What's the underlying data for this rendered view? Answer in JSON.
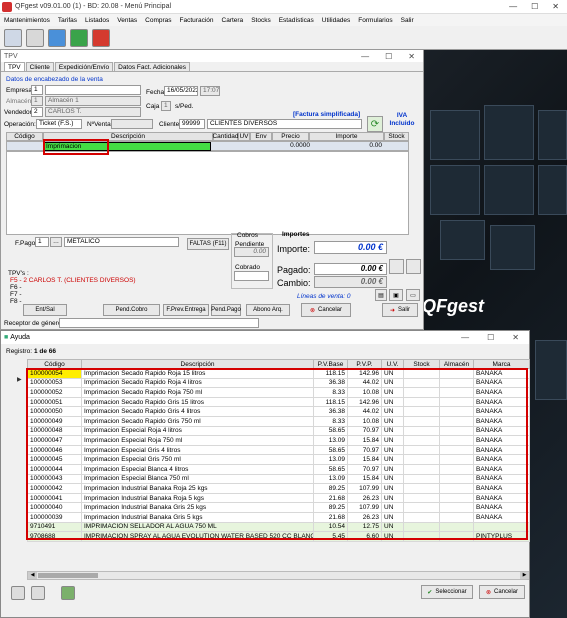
{
  "app": {
    "title": "QFgest v09.01.00 (1) - BD: 20.08 - Menú Principal",
    "menu": [
      "Mantenimientos",
      "Tarifas",
      "Listados",
      "Ventas",
      "Compras",
      "Facturación",
      "Cartera",
      "Stocks",
      "Estadísticas",
      "Utilidades",
      "Formularios",
      "Salir"
    ]
  },
  "tpv": {
    "title": "TPV",
    "tabs": [
      "TPV",
      "Cliente",
      "Expedición/Envío",
      "Datos Fact. Adicionales"
    ],
    "section": "Datos de encabezado de la venta",
    "empresa_label": "Empresa:",
    "empresa_code": "1",
    "empresa_name": "",
    "almacen_label": "Almacén:",
    "almacen_code": "1",
    "almacen_name": "Almacén 1",
    "vendedor_label": "Vendedor:",
    "vendedor_code": "2",
    "vendedor_name": "CARLOS T.",
    "fecha_label": "Fecha:",
    "fecha": "16/05/2022",
    "hora": "17:07",
    "caja_label": "Caja",
    "caja": "1",
    "sped_label": "s/Ped.",
    "factura_simplificada": "[Factura simplificada]",
    "iva_incluido": "IVA Incluido",
    "operacion_label": "Operación:",
    "operacion": "Ticket (F.S.)",
    "nventa_label": "NºVenta:",
    "cliente_label": "Cliente:",
    "cliente_code": "99999",
    "cliente_name": "CLIENTES DIVERSOS",
    "grid_headers": [
      "Código",
      "Descripción",
      "Cantidad",
      "UV",
      "Env",
      "Precio",
      "Importe",
      "Stock"
    ],
    "grid_row": {
      "codigo": "Imprimacion",
      "precio": "0.0000",
      "importe": "0.00"
    },
    "fpago_label": "F.Pago:",
    "fpago_code": "1",
    "fpago_name": "METALICO",
    "faltas_btn": "FALTAS (F11)",
    "cobros_label": "Cobros",
    "pendiente_label": "Pendiente",
    "pendiente_val": "0.00",
    "cobrado_label": "Cobrado",
    "importes_label": "Importes",
    "importe_label": "Importe:",
    "importe_val": "0.00 €",
    "pagado_label": "Pagado:",
    "pagado_val": "0.00 €",
    "cambio_label": "Cambio:",
    "cambio_val": "0.00 €",
    "lineas_label": "Líneas de venta: 0",
    "tpvs_label": "TPV's :",
    "f5_line": "F5 - 2 CARLOS T. (CLIENTES DIVERSOS)",
    "f6": "F6 -",
    "f7": "F7 -",
    "f8": "F8 -",
    "buttons": {
      "ent_sal": "Ent/Sal",
      "pend_cobro": "Pend.Cobro",
      "f_prev": "F.Prev.Entrega",
      "pend_pago": "Pend.Pago",
      "abono": "Abono Arq.",
      "cancelar": "Cancelar",
      "salir": "Salir"
    },
    "receptor_label": "Receptor de género"
  },
  "ayuda": {
    "title": "Ayuda",
    "registro": "Registro:",
    "registro_val": "1 de 66",
    "headers": [
      "Código",
      "Descripción",
      "P.V.Base",
      "P.V.P.",
      "U.V.",
      "Stock",
      "Almacén",
      "Marca"
    ],
    "rows": [
      [
        "100000054",
        "Imprimacion Secado Rapido Roja 15 litros",
        "118.15",
        "142.96",
        "UN",
        "",
        "",
        "BANAKA"
      ],
      [
        "100000053",
        "Imprimacion Secado Rapido Roja 4 litros",
        "36.38",
        "44.02",
        "UN",
        "",
        "",
        "BANAKA"
      ],
      [
        "100000052",
        "Imprimacion Secado Rapido Roja 750 ml",
        "8.33",
        "10.08",
        "UN",
        "",
        "",
        "BANAKA"
      ],
      [
        "100000051",
        "Imprimacion Secado Rapido Gris 15 litros",
        "118.15",
        "142.96",
        "UN",
        "",
        "",
        "BANAKA"
      ],
      [
        "100000050",
        "Imprimacion Secado Rapido Gris 4 litros",
        "36.38",
        "44.02",
        "UN",
        "",
        "",
        "BANAKA"
      ],
      [
        "100000049",
        "Imprimacion Secado Rapido Gris 750 ml",
        "8.33",
        "10.08",
        "UN",
        "",
        "",
        "BANAKA"
      ],
      [
        "100000048",
        "Imprimacion Especial Roja 4 litros",
        "58.65",
        "70.97",
        "UN",
        "",
        "",
        "BANAKA"
      ],
      [
        "100000047",
        "Imprimacion Especial Roja 750 ml",
        "13.09",
        "15.84",
        "UN",
        "",
        "",
        "BANAKA"
      ],
      [
        "100000046",
        "Imprimacion Especial Gris 4 litros",
        "58.65",
        "70.97",
        "UN",
        "",
        "",
        "BANAKA"
      ],
      [
        "100000045",
        "Imprimacion Especial Gris 750 ml",
        "13.09",
        "15.84",
        "UN",
        "",
        "",
        "BANAKA"
      ],
      [
        "100000044",
        "Imprimacion Especial Blanca 4 litros",
        "58.65",
        "70.97",
        "UN",
        "",
        "",
        "BANAKA"
      ],
      [
        "100000043",
        "Imprimacion Especial Blanca 750 ml",
        "13.09",
        "15.84",
        "UN",
        "",
        "",
        "BANAKA"
      ],
      [
        "100000042",
        "Imprimacion Industrial Banaka Roja 25 kgs",
        "89.25",
        "107.99",
        "UN",
        "",
        "",
        "BANAKA"
      ],
      [
        "100000041",
        "Imprimacion Industrial Banaka Roja 5 kgs",
        "21.68",
        "26.23",
        "UN",
        "",
        "",
        "BANAKA"
      ],
      [
        "100000040",
        "Imprimacion Industrial Banaka Gris 25 kgs",
        "89.25",
        "107.99",
        "UN",
        "",
        "",
        "BANAKA"
      ],
      [
        "100000039",
        "Imprimacion Industrial Banaka Gris 5 kgs",
        "21.68",
        "26.23",
        "UN",
        "",
        "",
        "BANAKA"
      ],
      [
        "9710491",
        "IMPRIMACION SELLADOR AL AGUA 750 ML",
        "10.54",
        "12.75",
        "UN",
        "",
        "",
        ""
      ],
      [
        "9708688",
        "IMPRIMACION SPRAY AL AGUA EVOLUTION WATER BASED 520 CC BLANCO",
        "5.45",
        "6.60",
        "UN",
        "",
        "",
        "PINTYPLUS"
      ]
    ],
    "seleccionar": "Seleccionar",
    "cancelar": "Cancelar"
  }
}
